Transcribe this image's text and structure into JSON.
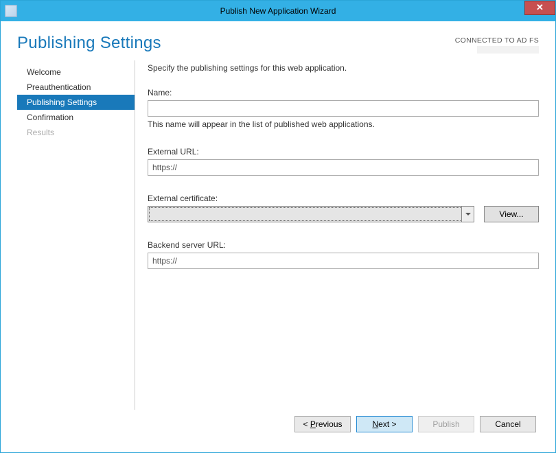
{
  "window": {
    "title": "Publish New Application Wizard",
    "close_glyph": "✕"
  },
  "header": {
    "heading": "Publishing Settings",
    "connection_status": "CONNECTED TO AD FS"
  },
  "sidebar": {
    "items": [
      {
        "label": "Welcome",
        "state": "normal"
      },
      {
        "label": "Preauthentication",
        "state": "normal"
      },
      {
        "label": "Publishing Settings",
        "state": "active"
      },
      {
        "label": "Confirmation",
        "state": "normal"
      },
      {
        "label": "Results",
        "state": "disabled"
      }
    ]
  },
  "form": {
    "intro": "Specify the publishing settings for this web application.",
    "name_label": "Name:",
    "name_value": "",
    "name_note": "This name will appear in the list of published web applications.",
    "external_url_label": "External URL:",
    "external_url_value": "https://",
    "external_cert_label": "External certificate:",
    "external_cert_value": "",
    "view_button": "View...",
    "backend_url_label": "Backend server URL:",
    "backend_url_value": "https://"
  },
  "footer": {
    "previous": "< Previous",
    "next": "Next >",
    "publish": "Publish",
    "cancel": "Cancel"
  }
}
